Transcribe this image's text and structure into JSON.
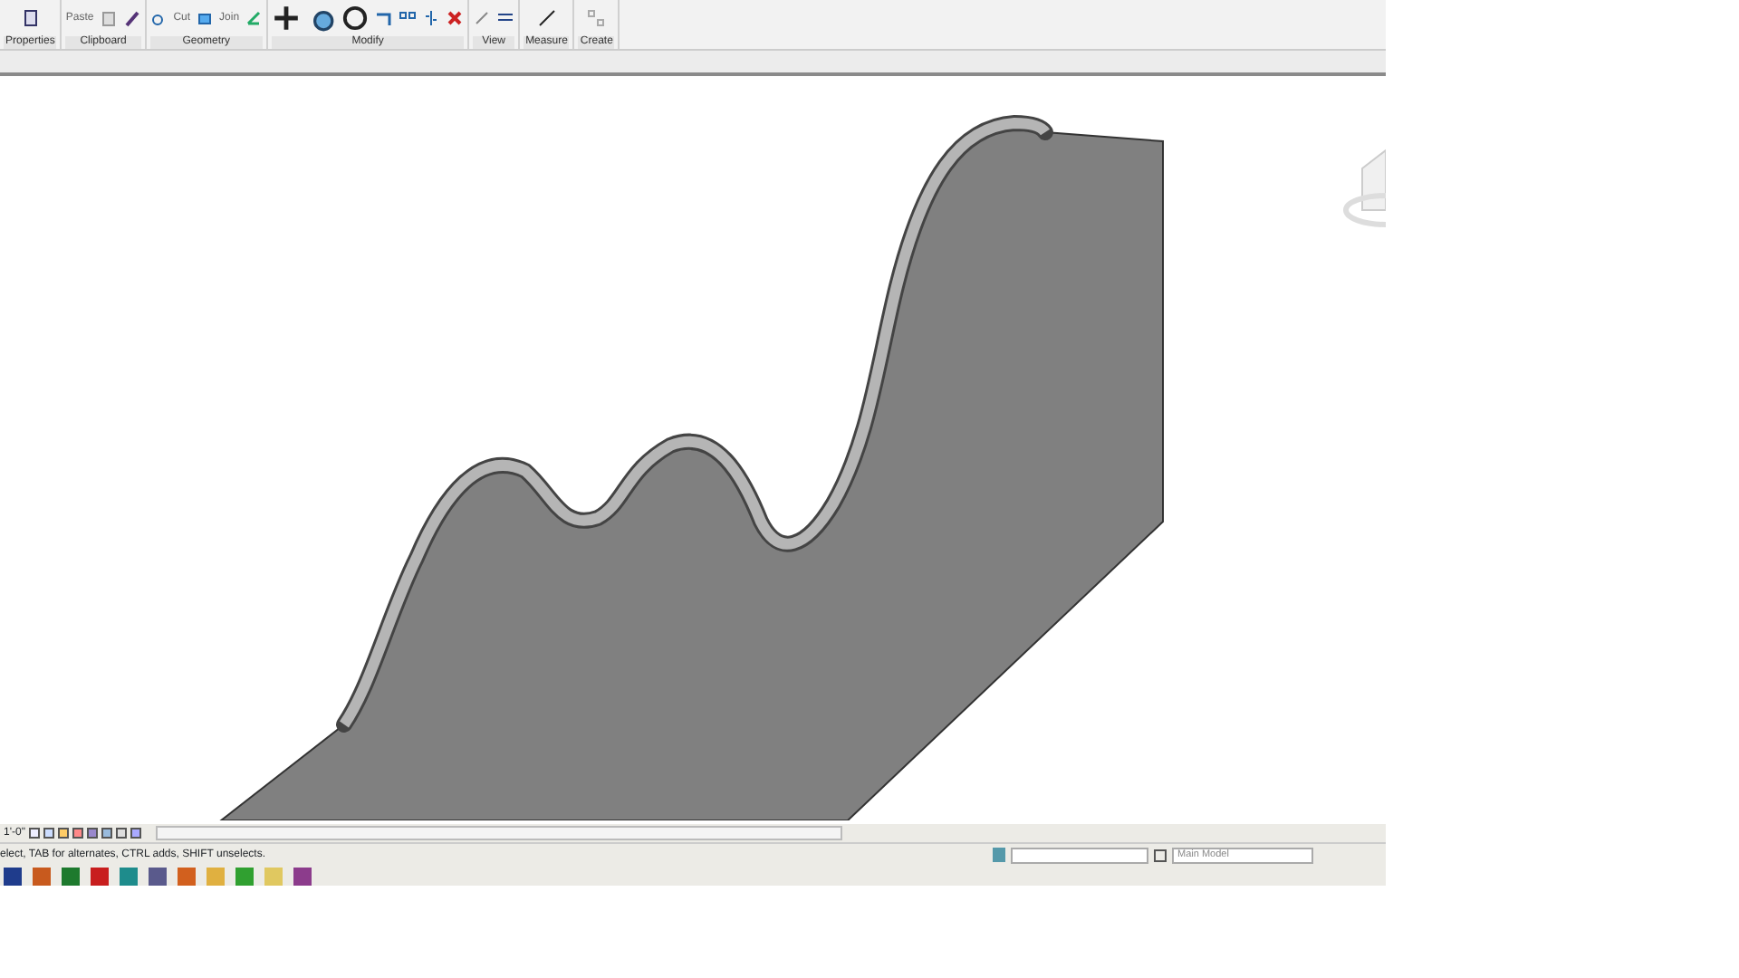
{
  "ribbon": {
    "tool_labels": [
      "Paste",
      "Cut",
      "Join"
    ],
    "panels": [
      {
        "label": "Properties"
      },
      {
        "label": "Clipboard"
      },
      {
        "label": "Geometry"
      },
      {
        "label": "Modify"
      },
      {
        "label": "View"
      },
      {
        "label": "Measure"
      },
      {
        "label": "Create"
      }
    ]
  },
  "view_bar": {
    "scale": "1'-0\""
  },
  "status_bar": {
    "message": "elect, TAB for alternates, CTRL adds, SHIFT unselects.",
    "model": "Main Model"
  }
}
